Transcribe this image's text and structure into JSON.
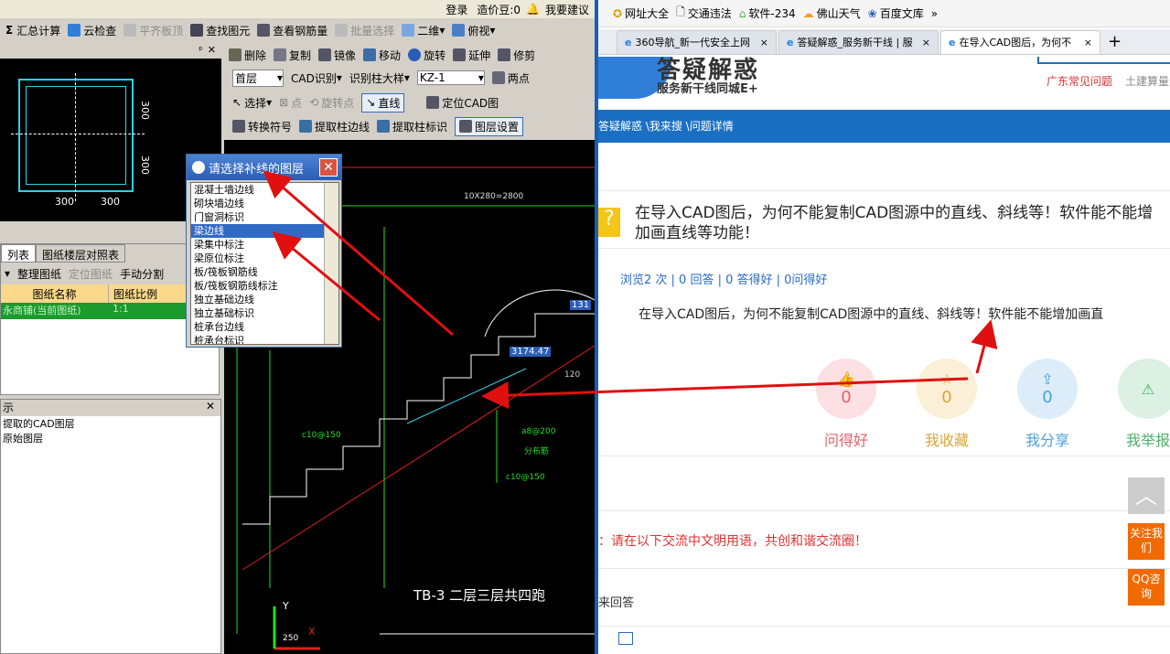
{
  "left_app": {
    "top_links": {
      "login": "登录",
      "points": "造价豆:0",
      "suggest": "我要建议"
    },
    "toolbar1": {
      "summary": "汇总计算",
      "cloud_check": "云检查",
      "flat_top": "平齐板顶",
      "find_element": "查找图元",
      "view_rebar": "查看钢筋量",
      "batch_select": "批量选择",
      "view_2d": "二维",
      "view_top": "俯视"
    },
    "toolbar2": {
      "delete": "删除",
      "copy": "复制",
      "mirror": "镜像",
      "move": "移动",
      "rotate": "旋转",
      "extend": "延伸",
      "modify": "修剪"
    },
    "toolbar3": {
      "floor": "首层",
      "cad_identify": "CAD识别",
      "identify_column": "识别柱大样",
      "column_id": "KZ-1",
      "two_point": "两点"
    },
    "toolbar4": {
      "select": "选择",
      "point": "点",
      "rotate_point": "旋转点",
      "line": "直线",
      "locate_cad": "定位CAD图"
    },
    "toolbar5": {
      "convert_symbol": "转换符号",
      "extract_column_edge": "提取柱边线",
      "extract_column_label": "提取柱标识",
      "layer_setting": "图层设置"
    },
    "preview": {
      "dim_top": "300",
      "dim_bottom": "300",
      "dim_left": "300",
      "dim_right": "300"
    },
    "drawing_panel": {
      "tab_list": "列表",
      "tab_floor": "图纸楼层对照表",
      "btn_organize": "整理图纸",
      "btn_locate": "定位图纸",
      "btn_split": "手动分割",
      "col_name": "图纸名称",
      "col_scale": "图纸比例",
      "row_name": "永商铺(当前图纸)",
      "row_scale": "1:1"
    },
    "layer_panel": {
      "title": "示",
      "item1": "提取的CAD图层",
      "item2": "原始图层"
    },
    "cad": {
      "dim_top": "10X280=2800",
      "value_box": "3174.47",
      "label_131": "131",
      "label_120": "120",
      "rebar1": "c10@150",
      "rebar2": "a8@200",
      "rebar3": "分布筋",
      "rebar4": "c10@150",
      "title": "TB-3 二层三层共四跑",
      "axis_y": "Y",
      "axis_x": "X",
      "axis_num": "250"
    },
    "dialog": {
      "title": "请选择补线的图层",
      "items": [
        "混凝土墙边线",
        "砌块墙边线",
        "门窗洞标识",
        "梁边线",
        "梁集中标注",
        "梁原位标注",
        "板/筏板钢筋线",
        "板/筏板钢筋线标注",
        "独立基础边线",
        "独立基础标识",
        "桩承台边线",
        "桩承台标识"
      ],
      "selected": "梁边线"
    }
  },
  "browser": {
    "bookmarks": {
      "b1": "网址大全",
      "b2": "交通违法",
      "b3": "软件-234",
      "b4": "佛山天气",
      "b5": "百度文库"
    },
    "tabs": [
      "360导航_新一代安全上网",
      "答疑解惑_服务新干线 | 服",
      "在导入CAD图后，为何不"
    ],
    "logo_title": "答疑解惑",
    "logo_sub": "服务新干线同城E+",
    "links": {
      "faq": "广东常见问题",
      "soil": "土建算量"
    },
    "breadcrumb": "答疑解惑 \\我来搜 \\问题详情",
    "question_title": "在导入CAD图后，为何不能复制CAD图源中的直线、斜线等！软件能不能增加画直线等功能！",
    "stats": "浏览2 次 | 0 回答 | 0 答得好 | 0问得好",
    "question_body": "在导入CAD图后，为何不能复制CAD图源中的直线、斜线等！软件能不能增加画直",
    "actions": [
      {
        "label": "问得好",
        "count": "0",
        "color": "#e5606a",
        "bg": "#fde0e3"
      },
      {
        "label": "我收藏",
        "count": "0",
        "color": "#d9a63a",
        "bg": "#fcefd8"
      },
      {
        "label": "我分享",
        "count": "0",
        "color": "#4a9fd8",
        "bg": "#dcedf9"
      },
      {
        "label": "我举报",
        "count": "",
        "color": "#4caf6a",
        "bg": "#dcf1e3"
      }
    ],
    "notice": "：请在以下交流中文明用语，共创和谐交流圈！",
    "answer_label": "来回答",
    "side": {
      "follow": "关注我们",
      "qq": "QQ咨询"
    }
  }
}
